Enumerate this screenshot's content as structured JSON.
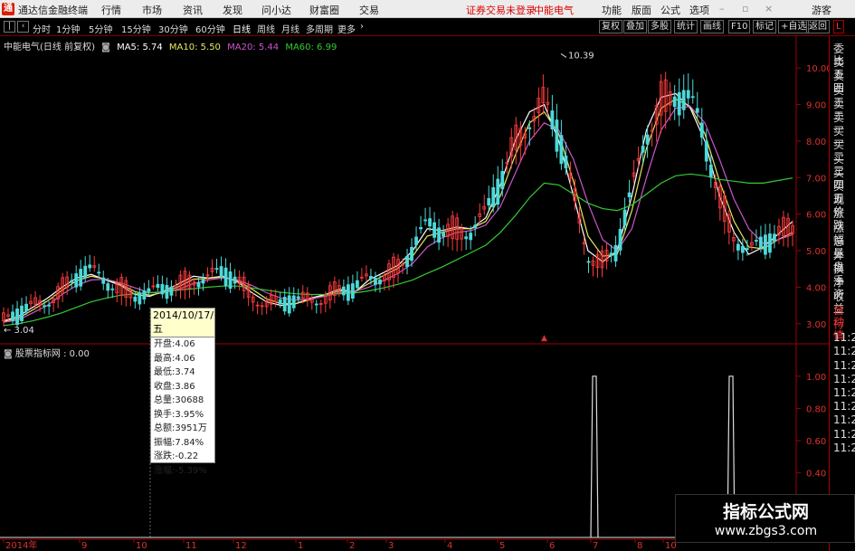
{
  "menubar": {
    "app_title": "通达信金融终端",
    "items": [
      "行情",
      "市场",
      "资讯",
      "发现",
      "问小达",
      "财富圈",
      "交易"
    ],
    "notice_login": "证券交易未登录",
    "notice_stock": "中能电气",
    "right_items": [
      "功能",
      "版面",
      "公式",
      "选项"
    ],
    "user": "游客"
  },
  "toolbar": {
    "periods": [
      "分时",
      "1分钟",
      "5分钟",
      "15分钟",
      "30分钟",
      "60分钟",
      "日线",
      "周线",
      "月线",
      "多周期",
      "更多"
    ],
    "active_period": "日线",
    "right_buttons": [
      "复权",
      "叠加",
      "多股",
      "统计",
      "画线",
      "F10",
      "标记",
      "+自选",
      "返回"
    ]
  },
  "legend": {
    "title": "中能电气(日线 前复权)",
    "ma5": "MA5: 5.74",
    "ma10": "MA10: 5.50",
    "ma20": "MA20: 5.44",
    "ma60": "MA60: 6.99"
  },
  "indicator": {
    "label": "股票指标网 : 0.00"
  },
  "tooltip": {
    "date": "2014/10/17/五",
    "rows": [
      "开盘:4.06",
      "最高:4.06",
      "最低:3.74",
      "收盘:3.86",
      "总量:30688",
      "换手:3.95%",
      "总额:3951万",
      "振幅:7.84%",
      "涨跌:-0.22",
      "涨幅:-5.39%"
    ]
  },
  "side_panel": [
    "委比",
    "卖五",
    "卖四",
    "卖三",
    "卖二",
    "卖一",
    "买一",
    "买二",
    "买三",
    "买四",
    "买五",
    "现价",
    "涨跌",
    "涨幅",
    "总量",
    "外盘",
    "换手",
    "净资",
    "收益",
    "自动",
    "行情",
    "11:2",
    "11:2",
    "11:2",
    "11:2",
    "11:2",
    "11:2",
    "11:2",
    "11:2",
    "11:2"
  ],
  "watermark": {
    "line1": "指标公式网",
    "line2": "www.zbgs3.com"
  },
  "colors": {
    "up": "#ff3b3b",
    "down": "#4dd9d9",
    "ma5": "#ffffff",
    "ma10": "#e8e860",
    "ma20": "#cc55cc",
    "ma60": "#33cc33",
    "axis": "#a00000"
  },
  "chart_data": [
    {
      "type": "line",
      "title": "",
      "x_tick_labels": [
        "2014年",
        "9",
        "10",
        "11",
        "12",
        "1",
        "2",
        "3",
        "4",
        "5",
        "6",
        "7",
        "8",
        "10"
      ],
      "y_tick_labels": [
        "3.00",
        "4.00",
        "5.00",
        "6.00",
        "7.00",
        "8.00",
        "9.00",
        "10.00"
      ],
      "ylim": [
        2.5,
        10.5
      ],
      "annotations": [
        "10.39",
        "3.04"
      ],
      "series": [
        {
          "name": "MA5",
          "color": "#ffffff",
          "values": [
            3.08,
            3.2,
            3.45,
            3.7,
            4.0,
            4.25,
            4.35,
            4.2,
            4.05,
            3.8,
            3.75,
            3.9,
            4.1,
            4.3,
            4.25,
            4.3,
            4.15,
            3.85,
            3.6,
            3.5,
            3.55,
            3.7,
            3.8,
            3.95,
            3.85,
            4.2,
            4.4,
            4.6,
            5.0,
            5.6,
            5.55,
            5.65,
            5.6,
            5.9,
            6.8,
            8.0,
            8.8,
            9.0,
            8.0,
            6.5,
            5.0,
            4.7,
            5.0,
            6.5,
            8.3,
            9.2,
            9.3,
            8.9,
            8.0,
            6.5,
            5.5,
            4.9,
            5.1,
            5.45,
            5.8
          ]
        },
        {
          "name": "MA10",
          "color": "#e8e860",
          "values": [
            3.06,
            3.15,
            3.38,
            3.62,
            3.92,
            4.18,
            4.3,
            4.22,
            4.08,
            3.88,
            3.78,
            3.86,
            4.02,
            4.22,
            4.24,
            4.28,
            4.18,
            3.95,
            3.68,
            3.55,
            3.55,
            3.66,
            3.78,
            3.9,
            3.88,
            4.1,
            4.32,
            4.52,
            4.85,
            5.4,
            5.5,
            5.6,
            5.6,
            5.8,
            6.5,
            7.6,
            8.5,
            8.8,
            8.2,
            6.9,
            5.4,
            4.85,
            4.9,
            6.1,
            7.8,
            8.9,
            9.15,
            8.95,
            8.2,
            6.9,
            5.8,
            5.1,
            5.05,
            5.3,
            5.5
          ]
        },
        {
          "name": "MA20",
          "color": "#cc55cc",
          "values": [
            3.04,
            3.1,
            3.3,
            3.5,
            3.8,
            4.05,
            4.2,
            4.22,
            4.12,
            3.98,
            3.85,
            3.85,
            3.95,
            4.1,
            4.2,
            4.25,
            4.2,
            4.05,
            3.85,
            3.7,
            3.65,
            3.68,
            3.75,
            3.85,
            3.88,
            4.0,
            4.18,
            4.38,
            4.65,
            5.1,
            5.35,
            5.5,
            5.55,
            5.7,
            6.2,
            7.1,
            8.0,
            8.5,
            8.3,
            7.5,
            6.3,
            5.3,
            5.0,
            5.6,
            7.0,
            8.3,
            8.9,
            8.95,
            8.5,
            7.5,
            6.4,
            5.6,
            5.2,
            5.3,
            5.44
          ]
        },
        {
          "name": "MA60",
          "color": "#33cc33",
          "values": [
            2.95,
            3.0,
            3.08,
            3.18,
            3.3,
            3.45,
            3.6,
            3.7,
            3.78,
            3.82,
            3.85,
            3.88,
            3.92,
            3.96,
            4.0,
            4.03,
            4.03,
            3.98,
            3.92,
            3.86,
            3.82,
            3.8,
            3.8,
            3.82,
            3.84,
            3.9,
            3.98,
            4.08,
            4.2,
            4.38,
            4.55,
            4.75,
            4.95,
            5.15,
            5.5,
            5.95,
            6.45,
            6.85,
            6.8,
            6.55,
            6.3,
            6.15,
            6.1,
            6.25,
            6.55,
            6.85,
            7.05,
            7.1,
            7.05,
            6.95,
            6.9,
            6.85,
            6.85,
            6.92,
            6.99
          ]
        }
      ]
    },
    {
      "type": "line",
      "title": "股票指标网",
      "y_tick_labels": [
        "0.40",
        "0.60",
        "0.80",
        "1.00"
      ],
      "ylim": [
        0,
        1.1
      ],
      "spikes": [
        {
          "label": "spike-1",
          "value": 1.0
        },
        {
          "label": "spike-2",
          "value": 1.0
        }
      ]
    }
  ]
}
